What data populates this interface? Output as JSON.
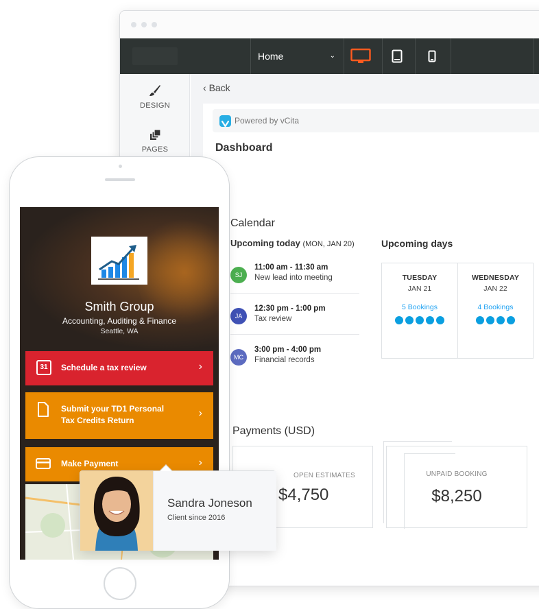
{
  "builder": {
    "page_select": "Home",
    "devices": [
      "desktop-icon",
      "tablet-icon",
      "mobile-icon"
    ],
    "sidebar": [
      {
        "label": "DESIGN",
        "icon": "brush-icon"
      },
      {
        "label": "PAGES",
        "icon": "pages-icon"
      }
    ],
    "back_label": "Back"
  },
  "dashboard": {
    "powered_by": "Powered by vCita",
    "title": "Dashboard",
    "calendar": {
      "title": "Calendar",
      "today_label": "Upcoming today",
      "today_date": "(MON, JAN 20)",
      "days_label": "Upcoming days",
      "meetings": [
        {
          "initials": "SJ",
          "color": "#4caf50",
          "time": "11:00 am - 11:30 am",
          "desc": "New lead into meeting"
        },
        {
          "initials": "JA",
          "color": "#3f51b5",
          "time": "12:30 pm - 1:00 pm",
          "desc": "Tax review"
        },
        {
          "initials": "MC",
          "color": "#5c6bc0",
          "time": "3:00 pm - 4:00 pm",
          "desc": "Financial records"
        }
      ],
      "days": [
        {
          "day": "TUESDAY",
          "date": "JAN 21",
          "bookings": "5 Bookings",
          "count": 5
        },
        {
          "day": "WEDNESDAY",
          "date": "JAN 22",
          "bookings": "4 Bookings",
          "count": 4
        }
      ]
    },
    "payments": {
      "title": "Payments",
      "currency": "(USD)",
      "cards": [
        {
          "label": "OPEN ESTIMATES",
          "value": "$4,750"
        },
        {
          "label": "UNPAID BOOKING",
          "value": "$8,250"
        }
      ]
    }
  },
  "mobile": {
    "business_name": "Smith Group",
    "tagline": "Accounting, Auditing & Finance",
    "location": "Seattle, WA",
    "actions": [
      {
        "line1": "Schedule a tax review",
        "line2": "",
        "color": "#d9232e",
        "icon": "calendar-31-icon"
      },
      {
        "line1": "Submit your TD1 Personal",
        "line2": "Tax Credits Return",
        "color": "#ea8a00",
        "icon": "document-icon"
      },
      {
        "line1": "Make Payment",
        "line2": "",
        "color": "#ea8a00",
        "icon": "credit-card-icon"
      }
    ],
    "calendar_icon_text": "31"
  },
  "client_card": {
    "name": "Sandra Joneson",
    "since": "Client since 2016"
  },
  "colors": {
    "accent_orange": "#ff5a1f",
    "nav_dark": "#2e3433",
    "link_blue": "#1da1f2",
    "booking_dot": "#0b9fe0"
  }
}
